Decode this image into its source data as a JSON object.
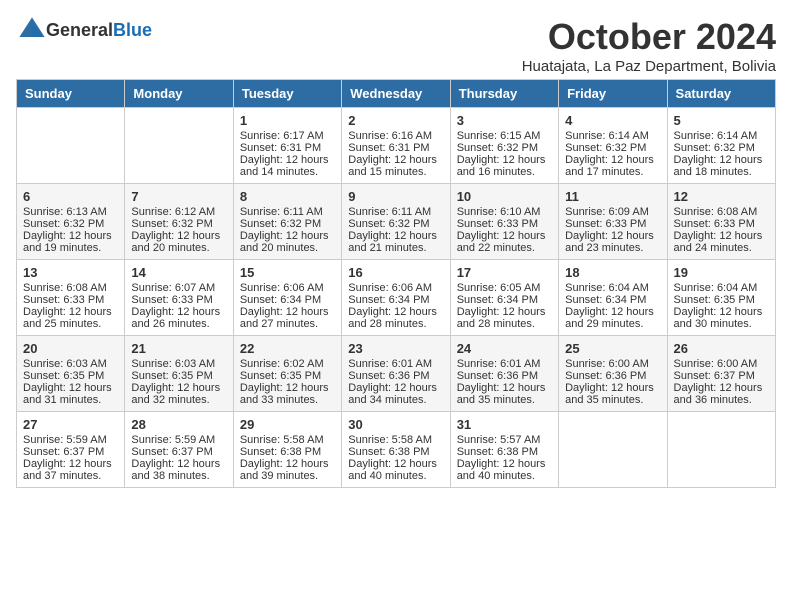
{
  "header": {
    "logo_general": "General",
    "logo_blue": "Blue",
    "month_title": "October 2024",
    "subtitle": "Huatajata, La Paz Department, Bolivia"
  },
  "weekdays": [
    "Sunday",
    "Monday",
    "Tuesday",
    "Wednesday",
    "Thursday",
    "Friday",
    "Saturday"
  ],
  "weeks": [
    [
      {
        "day": "",
        "sunrise": "",
        "sunset": "",
        "daylight": ""
      },
      {
        "day": "",
        "sunrise": "",
        "sunset": "",
        "daylight": ""
      },
      {
        "day": "1",
        "sunrise": "Sunrise: 6:17 AM",
        "sunset": "Sunset: 6:31 PM",
        "daylight": "Daylight: 12 hours and 14 minutes."
      },
      {
        "day": "2",
        "sunrise": "Sunrise: 6:16 AM",
        "sunset": "Sunset: 6:31 PM",
        "daylight": "Daylight: 12 hours and 15 minutes."
      },
      {
        "day": "3",
        "sunrise": "Sunrise: 6:15 AM",
        "sunset": "Sunset: 6:32 PM",
        "daylight": "Daylight: 12 hours and 16 minutes."
      },
      {
        "day": "4",
        "sunrise": "Sunrise: 6:14 AM",
        "sunset": "Sunset: 6:32 PM",
        "daylight": "Daylight: 12 hours and 17 minutes."
      },
      {
        "day": "5",
        "sunrise": "Sunrise: 6:14 AM",
        "sunset": "Sunset: 6:32 PM",
        "daylight": "Daylight: 12 hours and 18 minutes."
      }
    ],
    [
      {
        "day": "6",
        "sunrise": "Sunrise: 6:13 AM",
        "sunset": "Sunset: 6:32 PM",
        "daylight": "Daylight: 12 hours and 19 minutes."
      },
      {
        "day": "7",
        "sunrise": "Sunrise: 6:12 AM",
        "sunset": "Sunset: 6:32 PM",
        "daylight": "Daylight: 12 hours and 20 minutes."
      },
      {
        "day": "8",
        "sunrise": "Sunrise: 6:11 AM",
        "sunset": "Sunset: 6:32 PM",
        "daylight": "Daylight: 12 hours and 20 minutes."
      },
      {
        "day": "9",
        "sunrise": "Sunrise: 6:11 AM",
        "sunset": "Sunset: 6:32 PM",
        "daylight": "Daylight: 12 hours and 21 minutes."
      },
      {
        "day": "10",
        "sunrise": "Sunrise: 6:10 AM",
        "sunset": "Sunset: 6:33 PM",
        "daylight": "Daylight: 12 hours and 22 minutes."
      },
      {
        "day": "11",
        "sunrise": "Sunrise: 6:09 AM",
        "sunset": "Sunset: 6:33 PM",
        "daylight": "Daylight: 12 hours and 23 minutes."
      },
      {
        "day": "12",
        "sunrise": "Sunrise: 6:08 AM",
        "sunset": "Sunset: 6:33 PM",
        "daylight": "Daylight: 12 hours and 24 minutes."
      }
    ],
    [
      {
        "day": "13",
        "sunrise": "Sunrise: 6:08 AM",
        "sunset": "Sunset: 6:33 PM",
        "daylight": "Daylight: 12 hours and 25 minutes."
      },
      {
        "day": "14",
        "sunrise": "Sunrise: 6:07 AM",
        "sunset": "Sunset: 6:33 PM",
        "daylight": "Daylight: 12 hours and 26 minutes."
      },
      {
        "day": "15",
        "sunrise": "Sunrise: 6:06 AM",
        "sunset": "Sunset: 6:34 PM",
        "daylight": "Daylight: 12 hours and 27 minutes."
      },
      {
        "day": "16",
        "sunrise": "Sunrise: 6:06 AM",
        "sunset": "Sunset: 6:34 PM",
        "daylight": "Daylight: 12 hours and 28 minutes."
      },
      {
        "day": "17",
        "sunrise": "Sunrise: 6:05 AM",
        "sunset": "Sunset: 6:34 PM",
        "daylight": "Daylight: 12 hours and 28 minutes."
      },
      {
        "day": "18",
        "sunrise": "Sunrise: 6:04 AM",
        "sunset": "Sunset: 6:34 PM",
        "daylight": "Daylight: 12 hours and 29 minutes."
      },
      {
        "day": "19",
        "sunrise": "Sunrise: 6:04 AM",
        "sunset": "Sunset: 6:35 PM",
        "daylight": "Daylight: 12 hours and 30 minutes."
      }
    ],
    [
      {
        "day": "20",
        "sunrise": "Sunrise: 6:03 AM",
        "sunset": "Sunset: 6:35 PM",
        "daylight": "Daylight: 12 hours and 31 minutes."
      },
      {
        "day": "21",
        "sunrise": "Sunrise: 6:03 AM",
        "sunset": "Sunset: 6:35 PM",
        "daylight": "Daylight: 12 hours and 32 minutes."
      },
      {
        "day": "22",
        "sunrise": "Sunrise: 6:02 AM",
        "sunset": "Sunset: 6:35 PM",
        "daylight": "Daylight: 12 hours and 33 minutes."
      },
      {
        "day": "23",
        "sunrise": "Sunrise: 6:01 AM",
        "sunset": "Sunset: 6:36 PM",
        "daylight": "Daylight: 12 hours and 34 minutes."
      },
      {
        "day": "24",
        "sunrise": "Sunrise: 6:01 AM",
        "sunset": "Sunset: 6:36 PM",
        "daylight": "Daylight: 12 hours and 35 minutes."
      },
      {
        "day": "25",
        "sunrise": "Sunrise: 6:00 AM",
        "sunset": "Sunset: 6:36 PM",
        "daylight": "Daylight: 12 hours and 35 minutes."
      },
      {
        "day": "26",
        "sunrise": "Sunrise: 6:00 AM",
        "sunset": "Sunset: 6:37 PM",
        "daylight": "Daylight: 12 hours and 36 minutes."
      }
    ],
    [
      {
        "day": "27",
        "sunrise": "Sunrise: 5:59 AM",
        "sunset": "Sunset: 6:37 PM",
        "daylight": "Daylight: 12 hours and 37 minutes."
      },
      {
        "day": "28",
        "sunrise": "Sunrise: 5:59 AM",
        "sunset": "Sunset: 6:37 PM",
        "daylight": "Daylight: 12 hours and 38 minutes."
      },
      {
        "day": "29",
        "sunrise": "Sunrise: 5:58 AM",
        "sunset": "Sunset: 6:38 PM",
        "daylight": "Daylight: 12 hours and 39 minutes."
      },
      {
        "day": "30",
        "sunrise": "Sunrise: 5:58 AM",
        "sunset": "Sunset: 6:38 PM",
        "daylight": "Daylight: 12 hours and 40 minutes."
      },
      {
        "day": "31",
        "sunrise": "Sunrise: 5:57 AM",
        "sunset": "Sunset: 6:38 PM",
        "daylight": "Daylight: 12 hours and 40 minutes."
      },
      {
        "day": "",
        "sunrise": "",
        "sunset": "",
        "daylight": ""
      },
      {
        "day": "",
        "sunrise": "",
        "sunset": "",
        "daylight": ""
      }
    ]
  ]
}
